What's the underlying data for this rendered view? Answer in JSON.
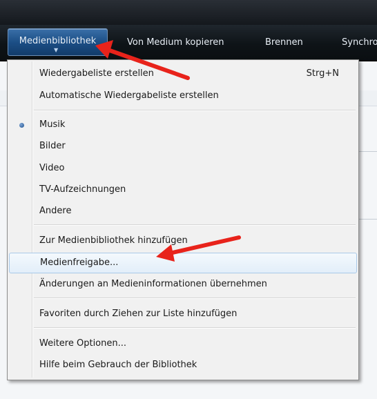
{
  "toolbar": {
    "tabs": [
      {
        "label": "Medienbibliothek"
      },
      {
        "label": "Von Medium kopieren"
      },
      {
        "label": "Brennen"
      },
      {
        "label": "Synchro"
      }
    ]
  },
  "menu": {
    "items": [
      {
        "label": "Wiedergabeliste erstellen",
        "shortcut": "Strg+N"
      },
      {
        "label": "Automatische Wiedergabeliste erstellen"
      },
      {
        "label": "Musik"
      },
      {
        "label": "Bilder"
      },
      {
        "label": "Video"
      },
      {
        "label": "TV-Aufzeichnungen"
      },
      {
        "label": "Andere"
      },
      {
        "label": "Zur Medienbibliothek hinzufügen"
      },
      {
        "label": "Medienfreigabe..."
      },
      {
        "label": "Änderungen an Medieninformationen übernehmen"
      },
      {
        "label": "Favoriten durch Ziehen zur Liste hinzufügen"
      },
      {
        "label": "Weitere Optionen..."
      },
      {
        "label": "Hilfe beim Gebrauch der Bibliothek"
      }
    ]
  },
  "colors": {
    "annotation_arrow": "#e8231b",
    "active_tab": "#1c4f86"
  }
}
